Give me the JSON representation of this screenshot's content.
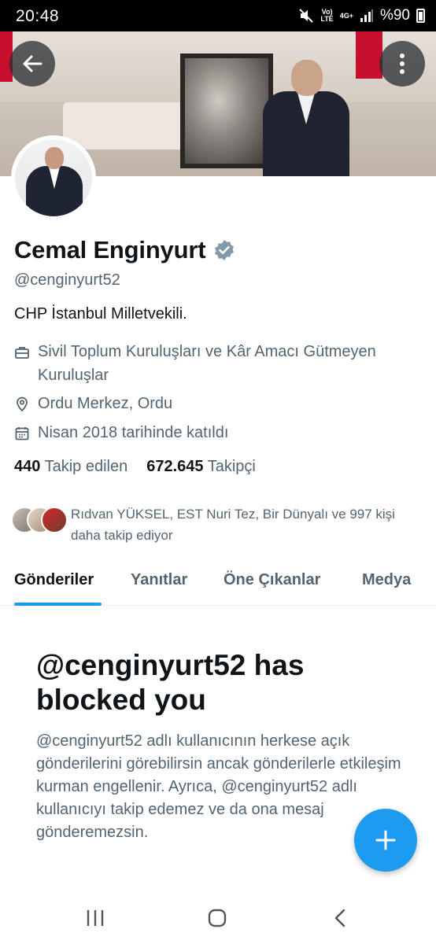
{
  "status_bar": {
    "time": "20:48",
    "network_top": "Vo)",
    "network_bottom": "LTE",
    "signal_gen": "4G+",
    "battery": "%90"
  },
  "profile": {
    "name": "Cemal Enginyurt",
    "handle": "@cenginyurt52",
    "bio": "CHP İstanbul Milletvekili.",
    "category": "Sivil Toplum Kuruluşları ve Kâr Amacı Gütmeyen Kuruluşlar",
    "location": "Ordu Merkez, Ordu",
    "joined": "Nisan 2018 tarihinde katıldı",
    "following_count": "440",
    "following_label": "Takip edilen",
    "followers_count": "672.645",
    "followers_label": "Takipçi",
    "known_followers": "Rıdvan YÜKSEL, EST Nuri Tez, Bir Dünyalı ve 997 kişi daha takip ediyor"
  },
  "tabs": [
    {
      "label": "Gönderiler",
      "active": true
    },
    {
      "label": "Yanıtlar",
      "active": false
    },
    {
      "label": "Öne Çıkanlar",
      "active": false
    },
    {
      "label": "Medya",
      "active": false
    }
  ],
  "blocked": {
    "title": "@cenginyurt52 has blocked you",
    "body": "@cenginyurt52 adlı kullanıcının herkese açık gönderilerini görebilirsin ancak gönderilerle etkileşim kurman engellenir. Ayrıca, @cenginyurt52 adlı kullanıcıyı takip edemez ve da ona mesaj gönderemezsin."
  },
  "icons": {
    "back": "arrow-left-icon",
    "more": "more-vertical-icon",
    "verified": "verified-badge-icon",
    "category": "briefcase-icon",
    "location": "location-pin-icon",
    "joined": "calendar-icon",
    "compose": "plus-icon"
  },
  "colors": {
    "accent": "#1d9bf0",
    "text_primary": "#0f1419",
    "text_secondary": "#536471",
    "verified": "#829aab"
  }
}
